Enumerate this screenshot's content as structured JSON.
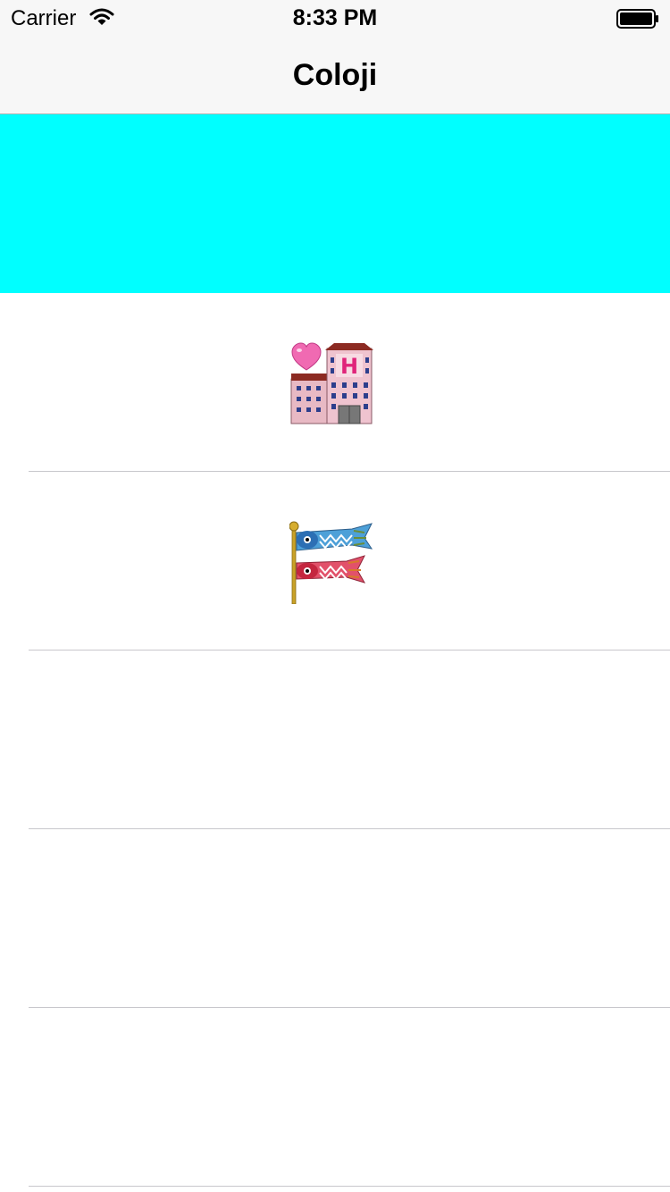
{
  "status_bar": {
    "carrier": "Carrier",
    "time": "8:33 PM",
    "wifi_icon": "wifi-icon",
    "battery_icon": "battery-icon"
  },
  "nav": {
    "title": "Coloji"
  },
  "list": {
    "rows": [
      {
        "kind": "color",
        "color": "#00ffff"
      },
      {
        "kind": "emoji",
        "icon": "love-hotel-icon"
      },
      {
        "kind": "emoji",
        "icon": "carp-streamer-icon"
      },
      {
        "kind": "empty"
      },
      {
        "kind": "empty"
      },
      {
        "kind": "empty"
      }
    ]
  },
  "colors": {
    "bar_background": "#f7f7f7",
    "cyan_row": "#00ffff",
    "separator": "#c8c7cc"
  }
}
